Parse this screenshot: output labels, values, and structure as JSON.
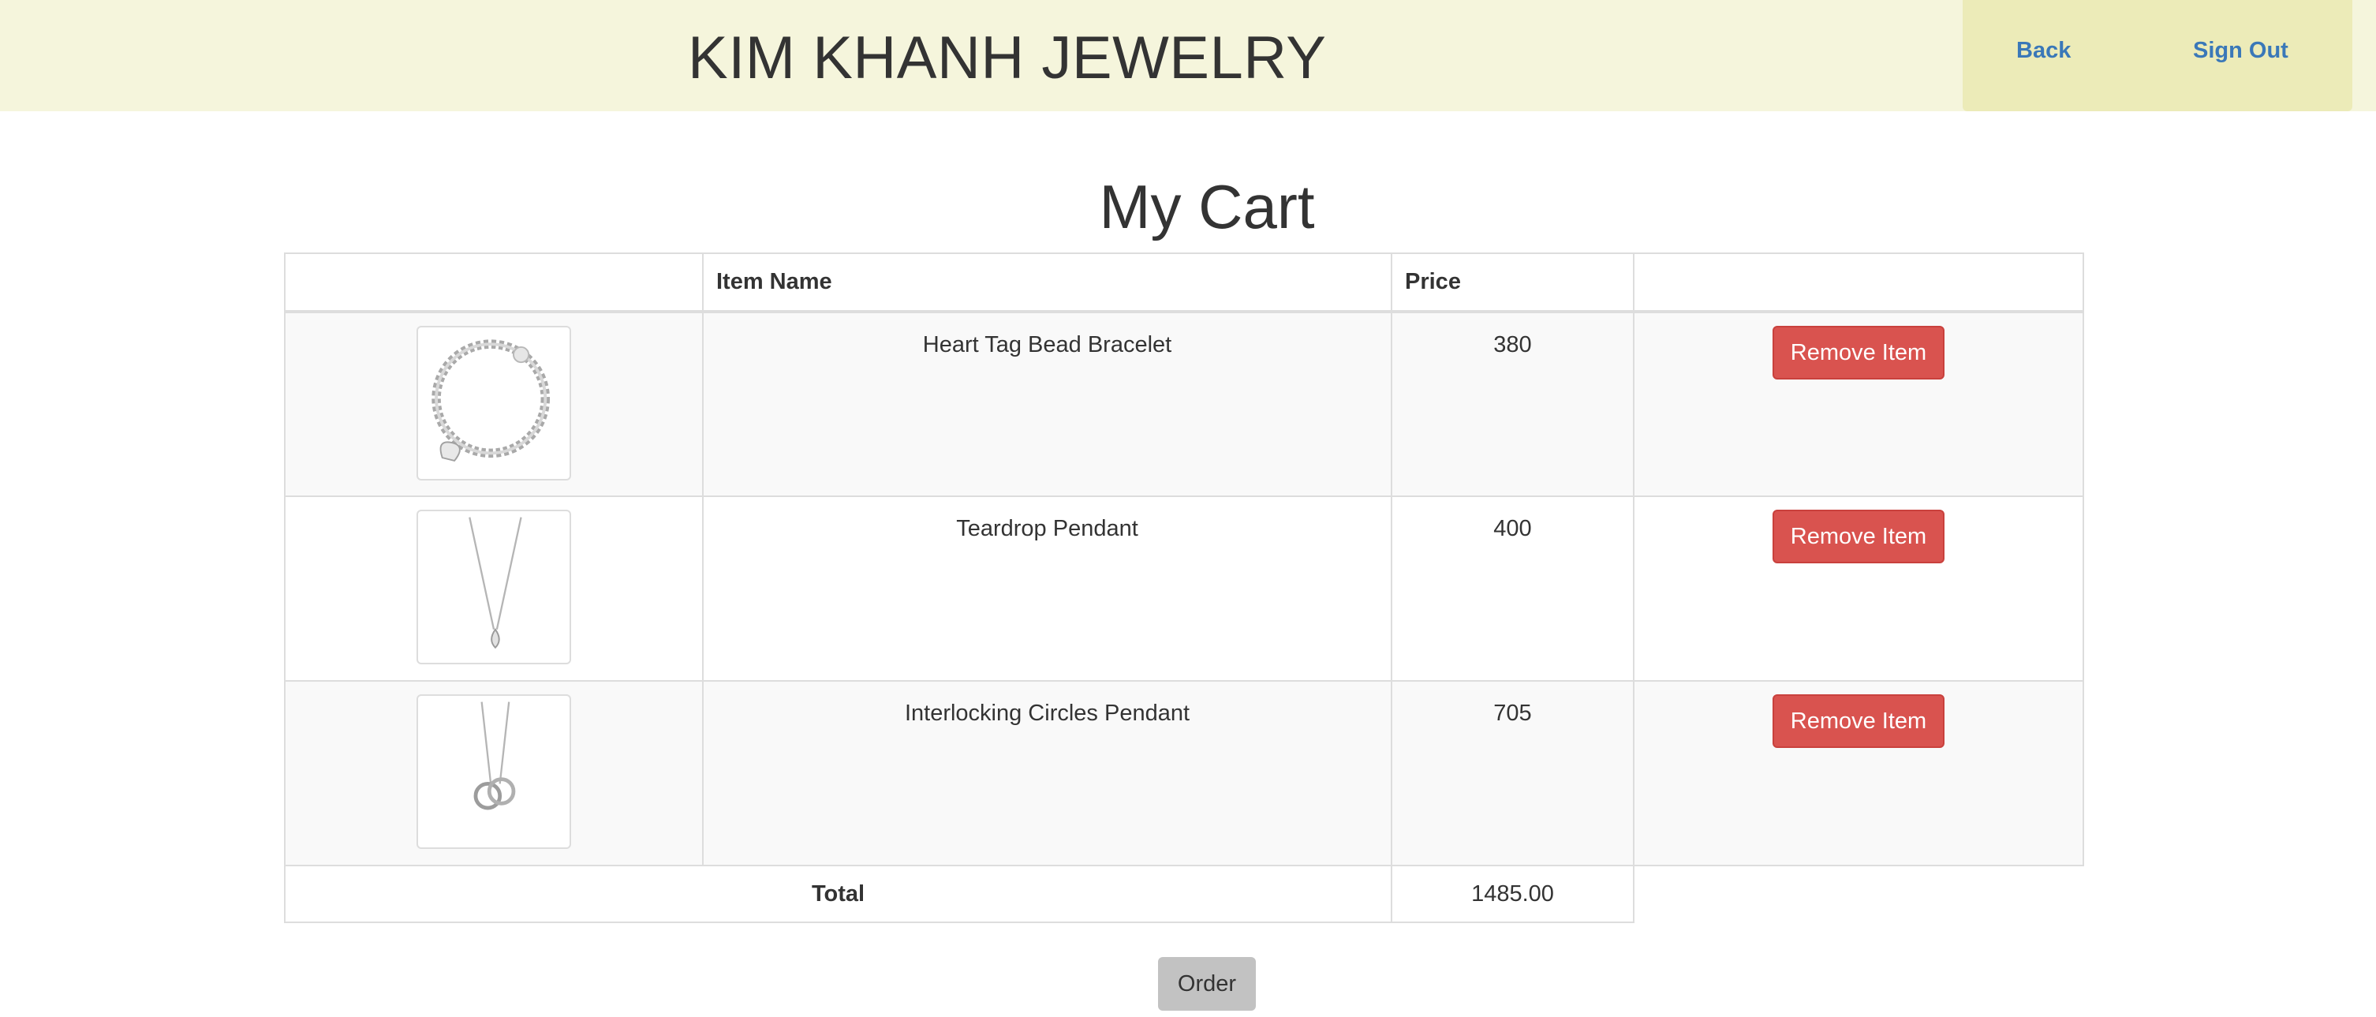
{
  "header": {
    "brand": "KIM KHANH JEWELRY",
    "nav": {
      "back_label": "Back",
      "signout_label": "Sign Out"
    },
    "colors": {
      "background": "#f5f5dc",
      "nav_background": "#ecebb8",
      "link": "#3a78b8"
    }
  },
  "main": {
    "title": "My Cart",
    "table": {
      "headers": [
        "",
        "Item Name",
        "Price",
        ""
      ],
      "rows": [
        {
          "image": "bracelet-image",
          "name": "Heart Tag Bead Bracelet",
          "price": "380",
          "action": "Remove Item"
        },
        {
          "image": "teardrop-pendant-image",
          "name": "Teardrop Pendant",
          "price": "400",
          "action": "Remove Item"
        },
        {
          "image": "interlocking-circles-pendant-image",
          "name": "Interlocking Circles Pendant",
          "price": "705",
          "action": "Remove Item"
        }
      ],
      "total_label": "Total",
      "total_value": "1485.00"
    },
    "order_label": "Order",
    "colors": {
      "remove_button": "#d9534f",
      "order_button": "#c2c2c2"
    }
  }
}
